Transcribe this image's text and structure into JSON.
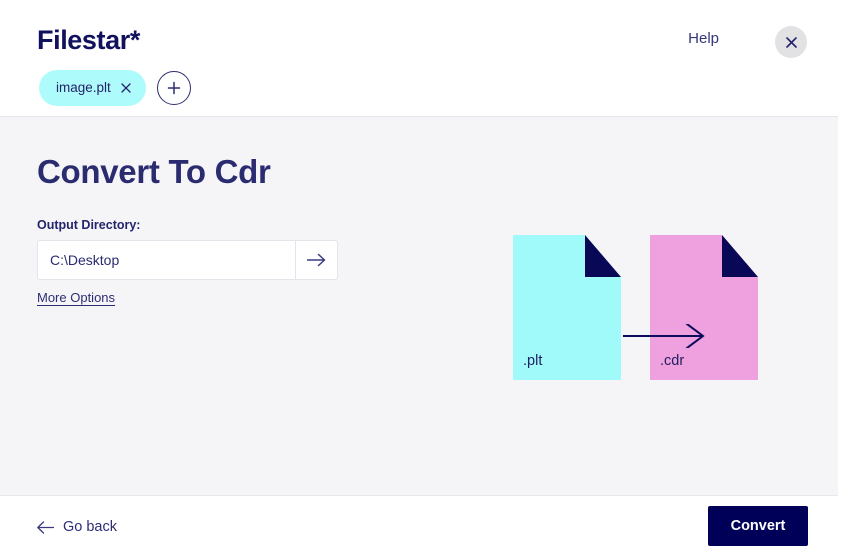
{
  "header": {
    "logo": "Filestar*",
    "help_label": "Help",
    "close_icon": "close-icon",
    "files": [
      {
        "name": "image.plt",
        "remove_icon": "close-icon"
      }
    ],
    "add_file_icon": "plus-icon"
  },
  "main": {
    "title": "Convert To Cdr",
    "output_directory": {
      "label": "Output Directory:",
      "value": "C:\\Desktop",
      "placeholder": "C:\\Desktop",
      "browse_icon": "arrow-right-icon"
    },
    "more_options_label": "More Options"
  },
  "illustration": {
    "source": {
      "extension": ".plt",
      "color": "#a0fafa",
      "fold_color": "#080857"
    },
    "target": {
      "extension": ".cdr",
      "color": "#efa0de",
      "fold_color": "#080857"
    },
    "arrow_icon": "arrow-right-icon"
  },
  "footer": {
    "back_label": "Go back",
    "back_icon": "arrow-left-icon",
    "convert_label": "Convert"
  },
  "colors": {
    "navy": "#000059",
    "accent_cyan": "#adfbfb",
    "accent_pink": "#efa0de",
    "page_bg": "#f5f5f8",
    "text_navy": "#2b2b70"
  }
}
